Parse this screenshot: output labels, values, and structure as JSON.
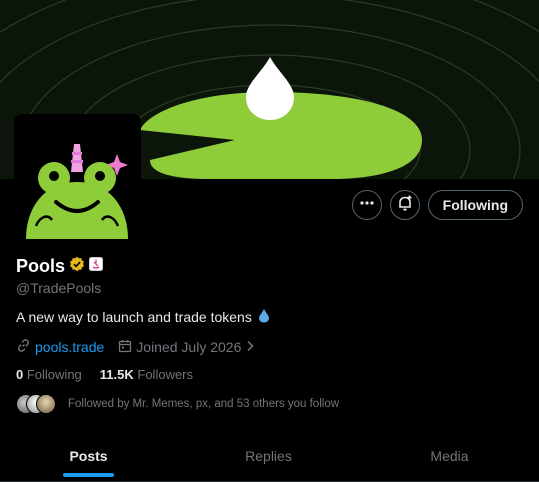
{
  "profile": {
    "name": "Pools",
    "handle": "@TradePools",
    "bio": "A new way to launch and trade tokens",
    "website": "pools.trade",
    "joined": "Joined July 2026"
  },
  "actions": {
    "more_icon": "more-icon",
    "notify_icon": "bell-plus-icon",
    "follow_label": "Following"
  },
  "stats": {
    "following_count": "0",
    "following_label": "Following",
    "followers_count": "11.5K",
    "followers_label": "Followers"
  },
  "followed_by": "Followed by Mr. Memes, px, and 53 others you follow",
  "tabs": [
    {
      "label": "Posts",
      "active": true
    },
    {
      "label": "Replies",
      "active": false
    },
    {
      "label": "Media",
      "active": false
    }
  ],
  "colors": {
    "accent": "#1d9bf0",
    "lilypad": "#8fcc3a",
    "verified_gold": "#e2b719"
  }
}
